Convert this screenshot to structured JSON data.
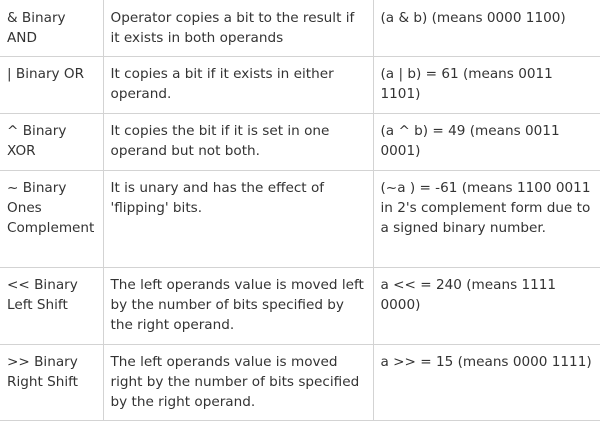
{
  "rows": [
    {
      "operator": "& Binary AND",
      "description": "Operator copies a bit to the result if it exists in both operands",
      "example": "(a & b) (means 0000 1100)"
    },
    {
      "operator": "| Binary OR",
      "description": "It copies a bit if it exists in either operand.",
      "example": "(a | b) = 61 (means 0011 1101)"
    },
    {
      "operator": "^ Binary XOR",
      "description": "It copies the bit if it is set in one operand but not both.",
      "example": "(a ^ b) = 49 (means 0011 0001)"
    },
    {
      "operator": "~ Binary Ones Complement",
      "description": "It is unary and has the effect of 'flipping' bits.",
      "example": "(~a ) = -61 (means 1100 0011 in 2's complement form due to a signed binary number."
    },
    {
      "operator": "<< Binary Left Shift",
      "description": "The left operands value is moved left by the number of bits specified by the right operand.",
      "example": "a << = 240 (means 1111 0000)"
    },
    {
      "operator": ">> Binary Right Shift",
      "description": "The left operands value is moved right by the number of bits specified by the right operand.",
      "example": "a >> = 15 (means 0000 1111)"
    }
  ]
}
